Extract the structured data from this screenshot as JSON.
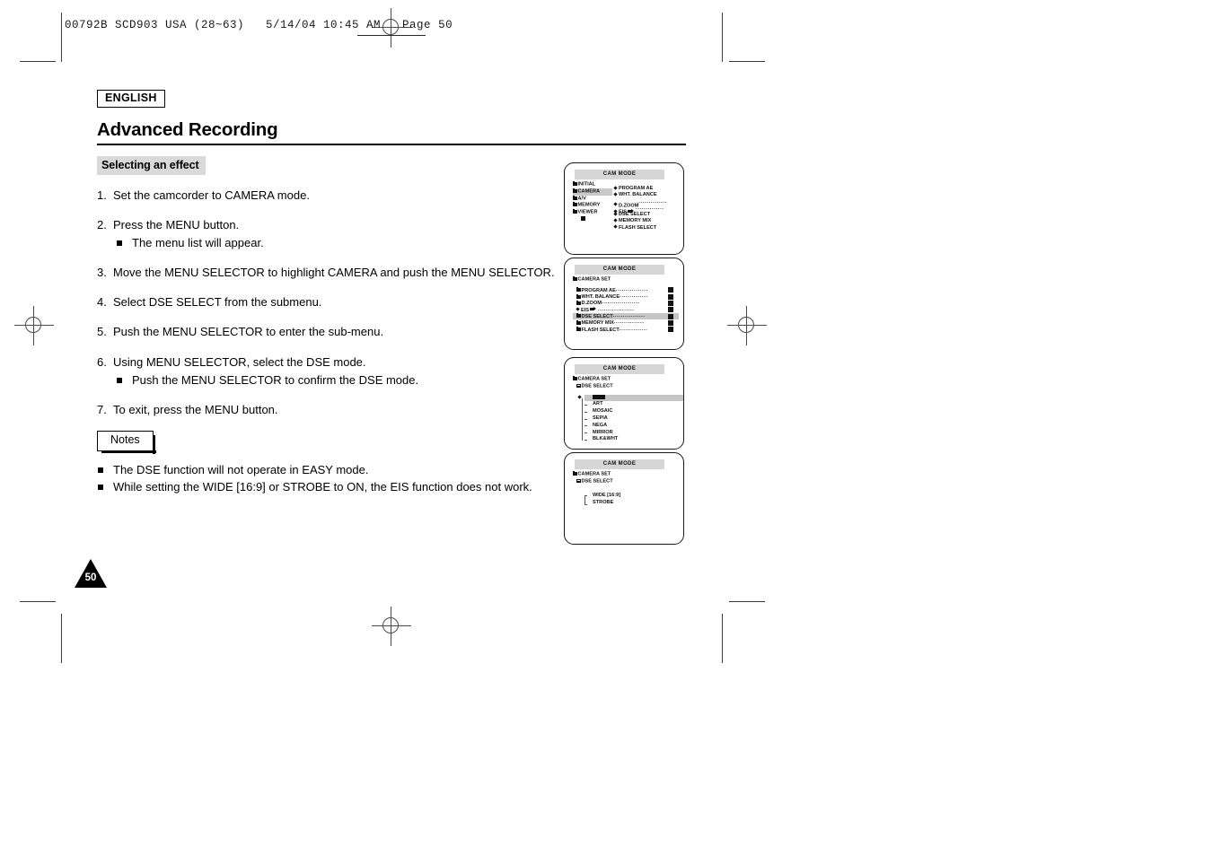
{
  "print_meta": {
    "header_line": "00792B SCD903 USA (28~63)   5/14/04 10:45 AM   Page 50"
  },
  "document": {
    "language_badge": "ENGLISH",
    "chapter_title": "Advanced Recording",
    "section_title": "Selecting an effect",
    "page_number": "50"
  },
  "steps": [
    {
      "num": "1.",
      "text": "Set the camcorder to CAMERA mode.",
      "sub": []
    },
    {
      "num": "2.",
      "text": "Press the MENU button.",
      "sub": [
        "The menu list will appear."
      ]
    },
    {
      "num": "3.",
      "text": "Move the MENU SELECTOR to highlight CAMERA and push the MENU SELECTOR.",
      "sub": []
    },
    {
      "num": "4.",
      "text": "Select DSE SELECT from the submenu.",
      "sub": []
    },
    {
      "num": "5.",
      "text": "Push the MENU SELECTOR to enter the sub-menu.",
      "sub": []
    },
    {
      "num": "6.",
      "text": "Using MENU SELECTOR, select the DSE mode.",
      "sub": [
        "Push the MENU SELECTOR to confirm the DSE mode."
      ]
    },
    {
      "num": "7.",
      "text": "To exit, press the MENU button.",
      "sub": []
    }
  ],
  "notes": {
    "label": "Notes",
    "items": [
      "The DSE function will not operate in EASY mode.",
      "While setting the WIDE [16:9] or STROBE to ON, the EIS function does not work."
    ]
  },
  "lcd_panels": [
    {
      "header": "CAM MODE",
      "left_column": [
        {
          "label": "INITIAL",
          "highlighted": false
        },
        {
          "label": "CAMERA",
          "highlighted": true
        },
        {
          "label": "A/V",
          "highlighted": false
        },
        {
          "label": "MEMORY",
          "highlighted": false
        },
        {
          "label": "VIEWER",
          "highlighted": false
        }
      ],
      "right_column": [
        {
          "label": "PROGRAM AE",
          "leader": "",
          "value": false,
          "cursor": false
        },
        {
          "label": "WHT. BALANCE",
          "leader": "",
          "value": false,
          "cursor": false
        },
        {
          "label": "D.ZOOM",
          "leader": "..............",
          "value": true,
          "cursor": false
        },
        {
          "label": "EIS",
          "leader": "..............",
          "value": true,
          "cursor": true
        },
        {
          "label": "DSE SELECT",
          "leader": "",
          "value": false,
          "cursor": false
        },
        {
          "label": "MEMORY MIX",
          "leader": "",
          "value": false,
          "cursor": false
        },
        {
          "label": "FLASH SELECT",
          "leader": "",
          "value": false,
          "cursor": false
        }
      ]
    },
    {
      "header": "CAM MODE",
      "title": "CAMERA SET",
      "rows": [
        {
          "label": "PROGRAM AE",
          "leader": "................",
          "highlighted": false,
          "cursor": false
        },
        {
          "label": "WHT. BALANCE",
          "leader": "..............",
          "highlighted": false,
          "cursor": false
        },
        {
          "label": "D.ZOOM",
          "leader": "...................",
          "highlighted": false,
          "cursor": false
        },
        {
          "label": "EIS",
          "leader": "..................",
          "highlighted": false,
          "cursor": true
        },
        {
          "label": "DSE SELECT",
          "leader": "................",
          "highlighted": true,
          "cursor": false
        },
        {
          "label": "MEMORY MIX",
          "leader": "...............",
          "highlighted": false,
          "cursor": false
        },
        {
          "label": "FLASH SELECT",
          "leader": "..............",
          "highlighted": false,
          "cursor": false
        }
      ]
    },
    {
      "header": "CAM MODE",
      "title": "CAMERA SET",
      "subtitle": "DSE SELECT",
      "options": [
        {
          "label": "",
          "selected": true,
          "is_block": true
        },
        {
          "label": "ART",
          "selected": false,
          "is_block": false
        },
        {
          "label": "MOSAIC",
          "selected": false,
          "is_block": false
        },
        {
          "label": "SEPIA",
          "selected": false,
          "is_block": false
        },
        {
          "label": "NEGA",
          "selected": false,
          "is_block": false
        },
        {
          "label": "MIRROR",
          "selected": false,
          "is_block": false
        },
        {
          "label": "BLK&WHT",
          "selected": false,
          "is_block": false
        }
      ]
    },
    {
      "header": "CAM MODE",
      "title": "CAMERA SET",
      "subtitle": "DSE SELECT",
      "options": [
        {
          "label": "WIDE [16:9]"
        },
        {
          "label": "STROBE"
        }
      ]
    }
  ]
}
